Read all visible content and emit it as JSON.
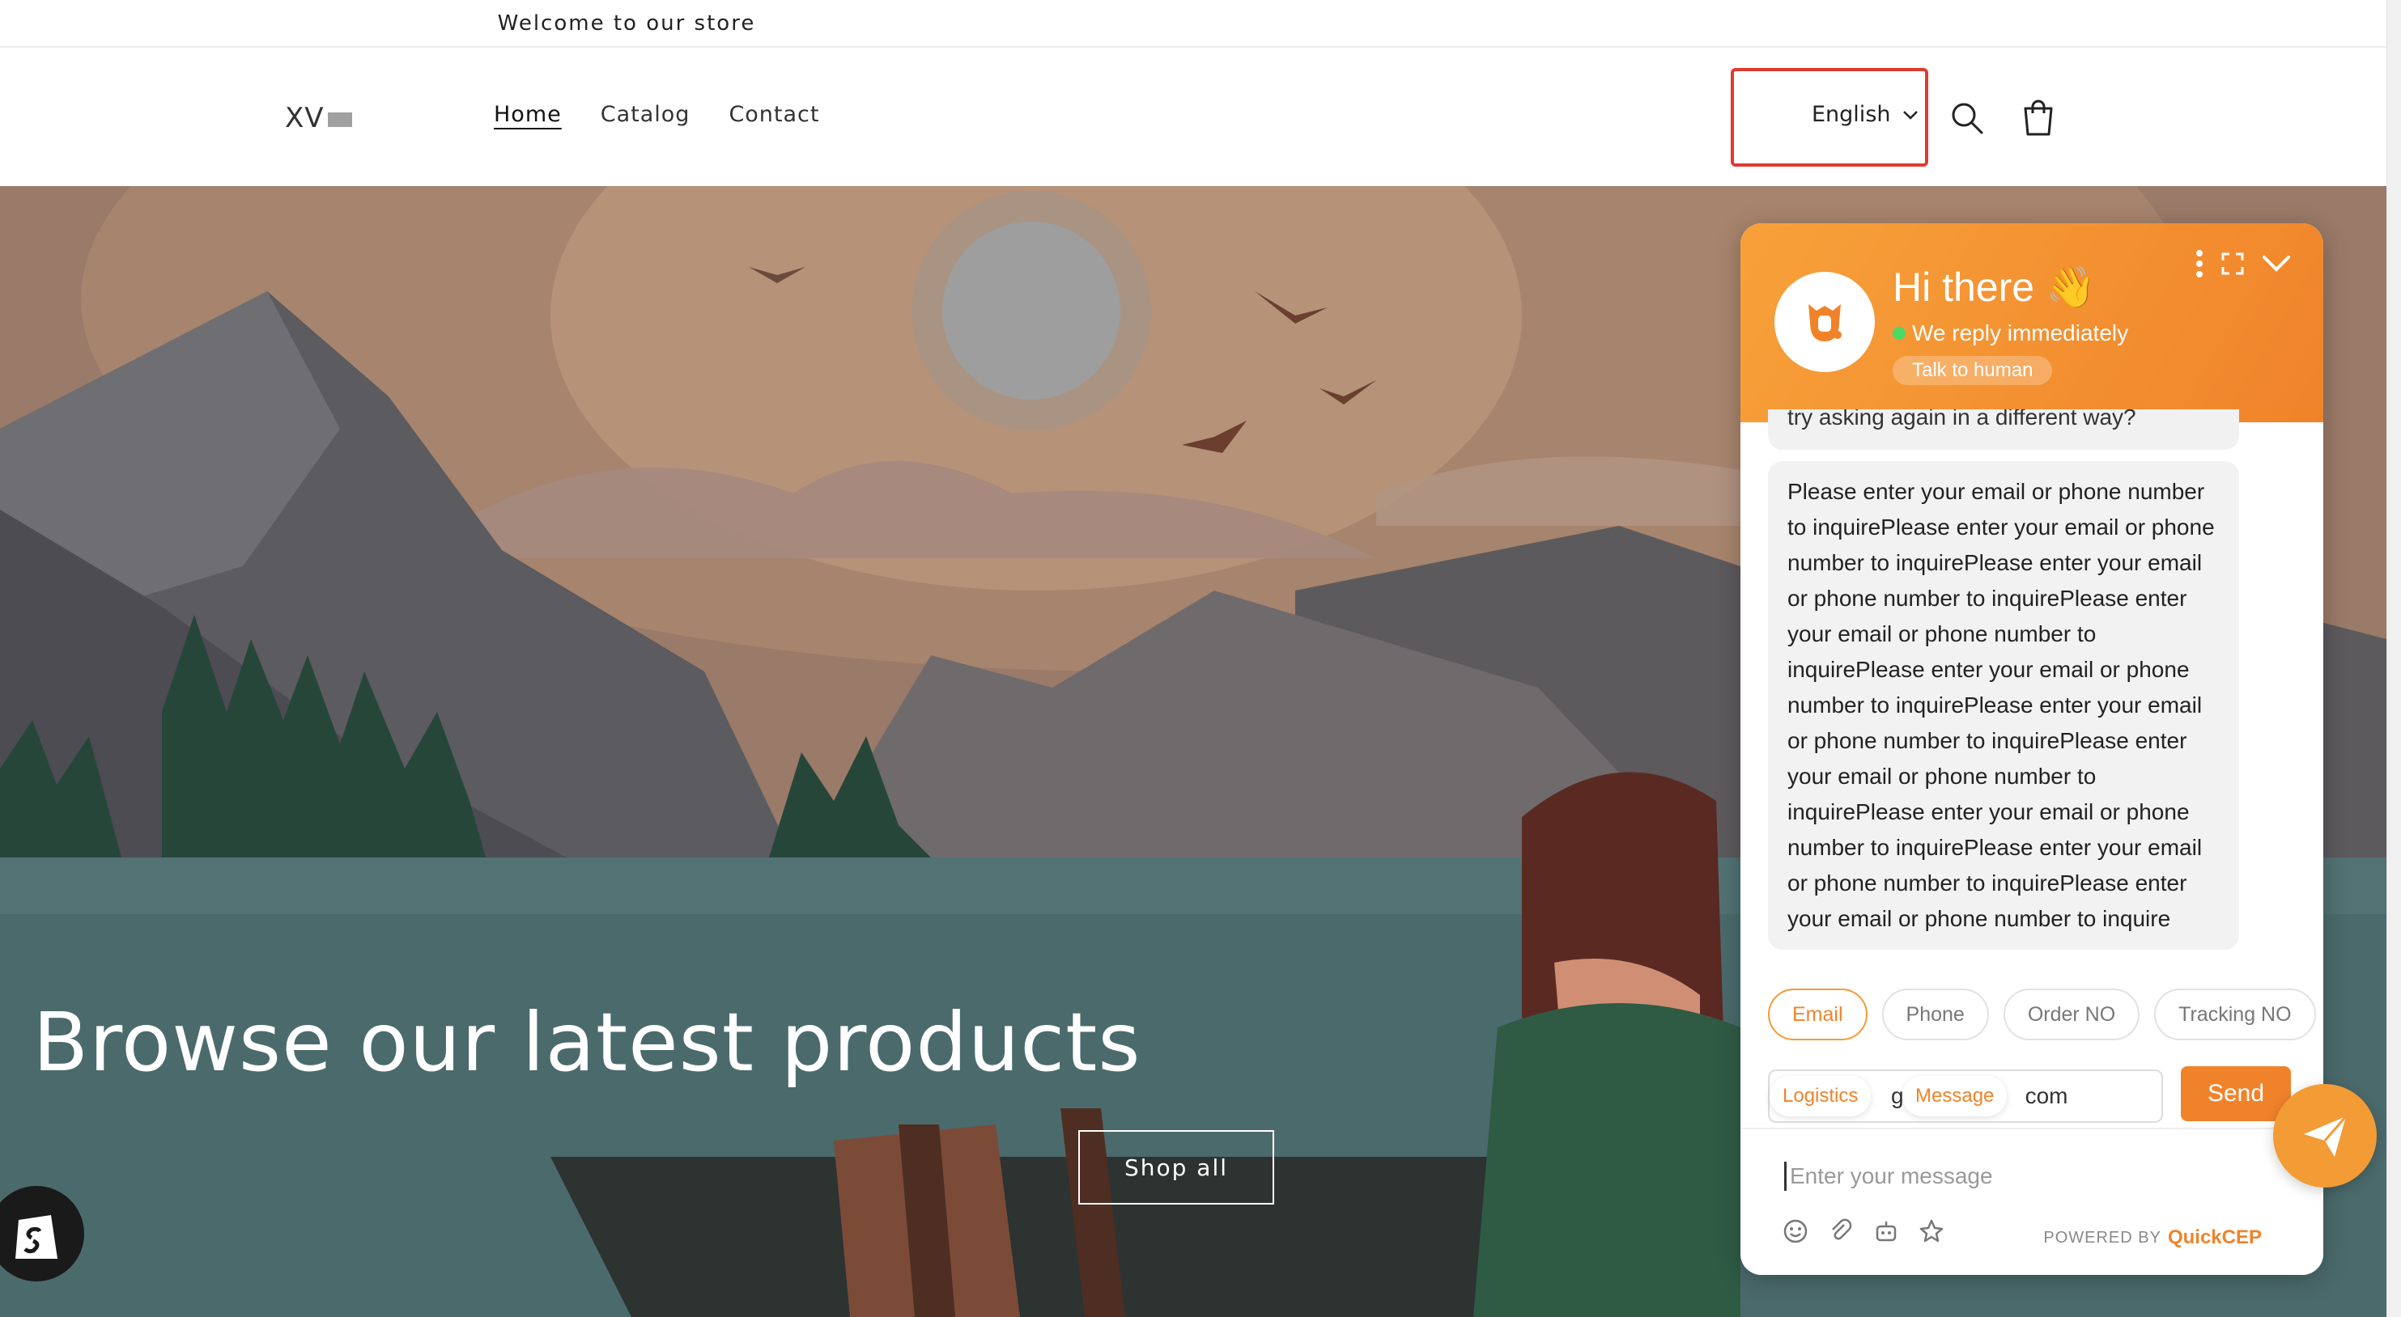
{
  "announcement": {
    "text": "Welcome to our store"
  },
  "header": {
    "logo_text": "XV",
    "nav": [
      {
        "label": "Home",
        "active": true
      },
      {
        "label": "Catalog",
        "active": false
      },
      {
        "label": "Contact",
        "active": false
      }
    ],
    "language": "English",
    "icons": [
      "chevron-down-icon",
      "search-icon",
      "cart-icon"
    ]
  },
  "hero": {
    "title": "Browse our latest products",
    "button_label": "Shop all"
  },
  "chat": {
    "title": "Hi there 👋",
    "status": "We reply immediately",
    "talk_to_human": "Talk to human",
    "previous_message_tail": "try asking again in a different way?",
    "message": "Please enter your email or phone number to inquirePlease enter your email or phone number to inquirePlease enter your email or phone number to inquirePlease enter your email or phone number to inquirePlease enter your email or phone number to inquirePlease enter your email or phone number to inquirePlease enter your email or phone number to inquirePlease enter your email or phone number to inquirePlease enter your email or phone number to inquirePlease enter your email or phone number to inquire",
    "quick_options": [
      {
        "label": "Email",
        "active": true
      },
      {
        "label": "Phone",
        "active": false
      },
      {
        "label": "Order NO",
        "active": false
      },
      {
        "label": "Tracking NO",
        "active": false
      }
    ],
    "email_value_fragment_1": "g",
    "email_value_fragment_2": "com",
    "send_label": "Send",
    "floating_tags": [
      "Logistics",
      "Message"
    ],
    "composer_placeholder": "Enter your message",
    "powered_by": "POWERED BY",
    "brand": "QuickCEP",
    "accent_color": "#f0832a"
  },
  "colors": {
    "highlight_box": "#e03a2f",
    "chat_orange": "#f0832a"
  }
}
